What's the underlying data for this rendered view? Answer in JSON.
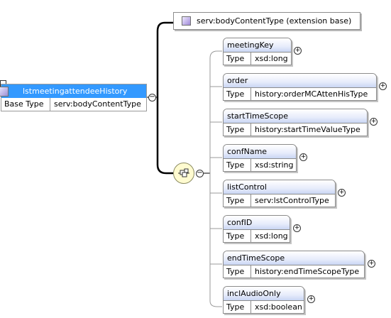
{
  "root": {
    "name": "lstmeetingattendeeHistory",
    "row_label": "Base Type",
    "row_value": "serv:bodyContentType"
  },
  "extension": {
    "label": "serv:bodyContentType (extension base)"
  },
  "elements": [
    {
      "name": "meetingKey",
      "type_label": "Type",
      "type": "xsd:long"
    },
    {
      "name": "order",
      "type_label": "Type",
      "type": "history:orderMCAttenHisType"
    },
    {
      "name": "startTimeScope",
      "type_label": "Type",
      "type": "history:startTimeValueType"
    },
    {
      "name": "confName",
      "type_label": "Type",
      "type": "xsd:string"
    },
    {
      "name": "listControl",
      "type_label": "Type",
      "type": "serv:lstControlType"
    },
    {
      "name": "confID",
      "type_label": "Type",
      "type": "xsd:long"
    },
    {
      "name": "endTimeScope",
      "type_label": "Type",
      "type": "history:endTimeScopeType"
    },
    {
      "name": "inclAudioOnly",
      "type_label": "Type",
      "type": "xsd:boolean"
    }
  ],
  "expander": {
    "plus": "+",
    "minus": "−"
  }
}
